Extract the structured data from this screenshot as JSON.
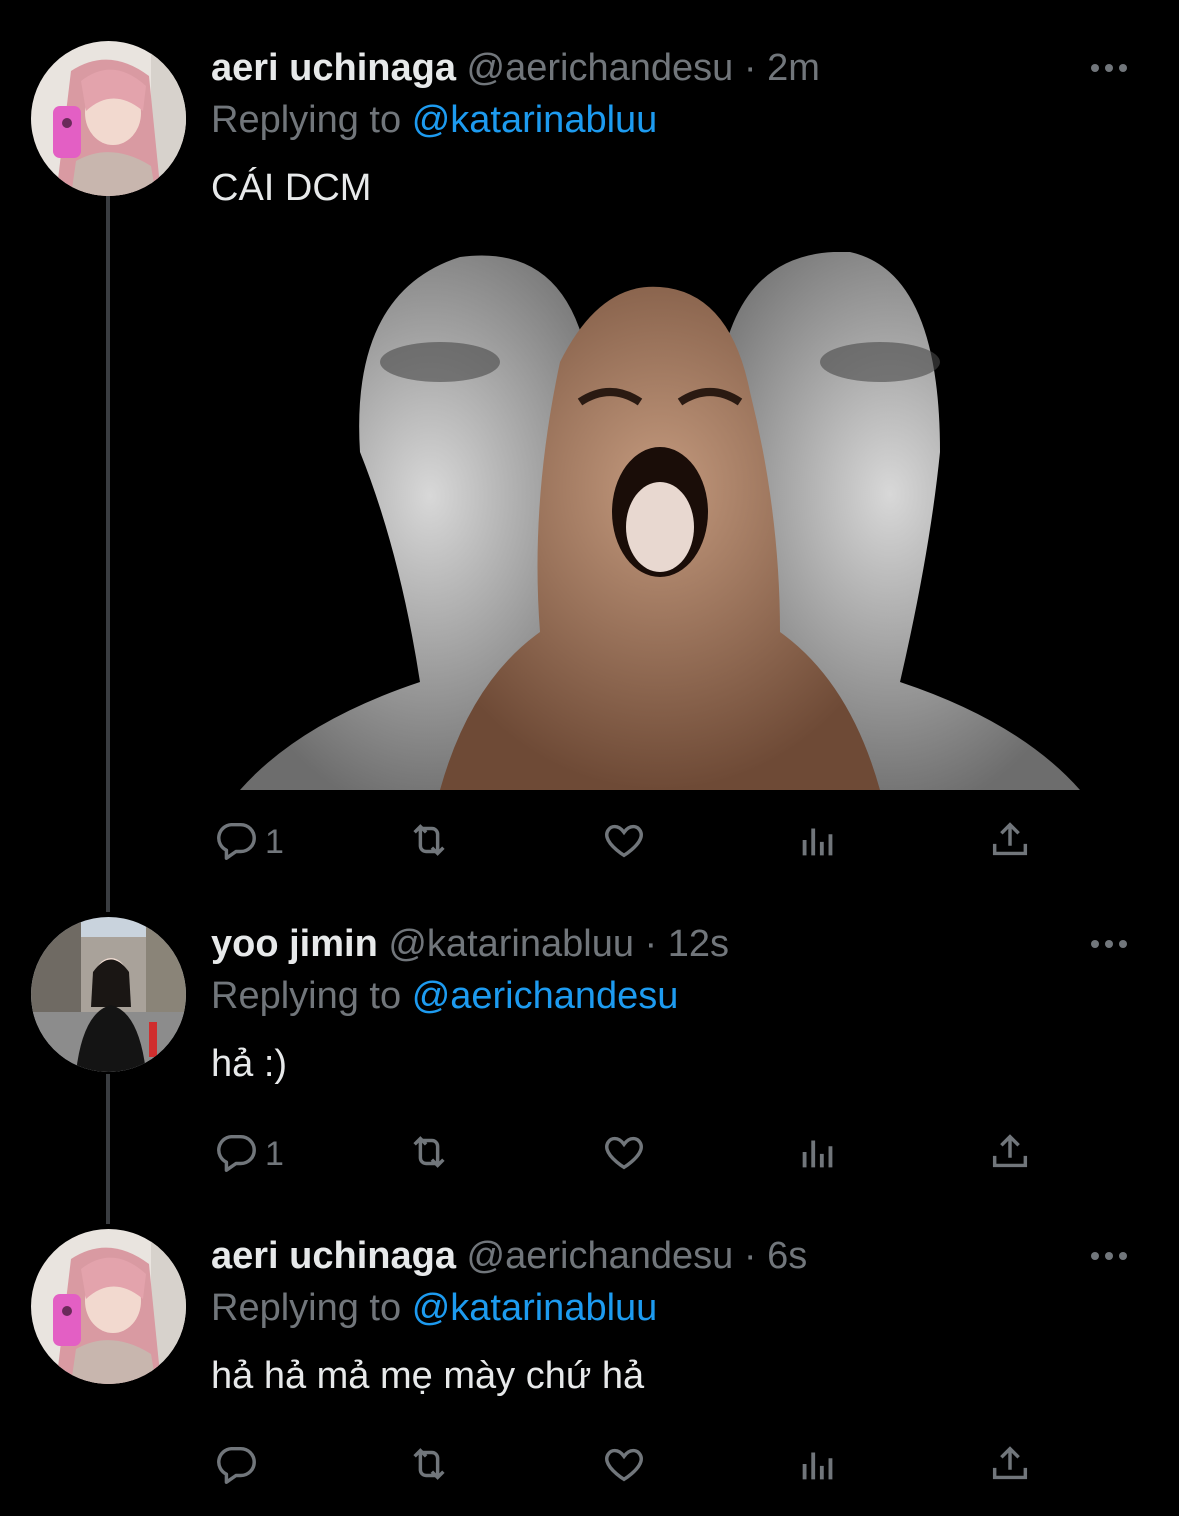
{
  "tweets": [
    {
      "name": "aeri uchinaga",
      "handle": "@aerichandesu",
      "separator": "·",
      "time": "2m",
      "replying_label": "Replying to",
      "replying_to": "@katarinabluu",
      "text": "CÁI DCM",
      "has_media": true,
      "reply_count": "1"
    },
    {
      "name": "yoo jimin",
      "handle": "@katarinabluu",
      "separator": "·",
      "time": "12s",
      "replying_label": "Replying to",
      "replying_to": "@aerichandesu",
      "text": "hả :)",
      "reply_count": "1"
    },
    {
      "name": "aeri uchinaga",
      "handle": "@aerichandesu",
      "separator": "·",
      "time": "6s",
      "replying_label": "Replying to",
      "replying_to": "@katarinabluu",
      "text": "hả hả mả mẹ mày chứ hả",
      "reply_count": ""
    }
  ],
  "colors": {
    "background": "#000000",
    "primary_text": "#e7e9ea",
    "secondary_text": "#71767b",
    "accent": "#1d9bf0",
    "thread_line": "#3a3d41"
  },
  "icons": [
    "more-icon",
    "reply-icon",
    "retweet-icon",
    "like-icon",
    "views-icon",
    "share-icon"
  ]
}
